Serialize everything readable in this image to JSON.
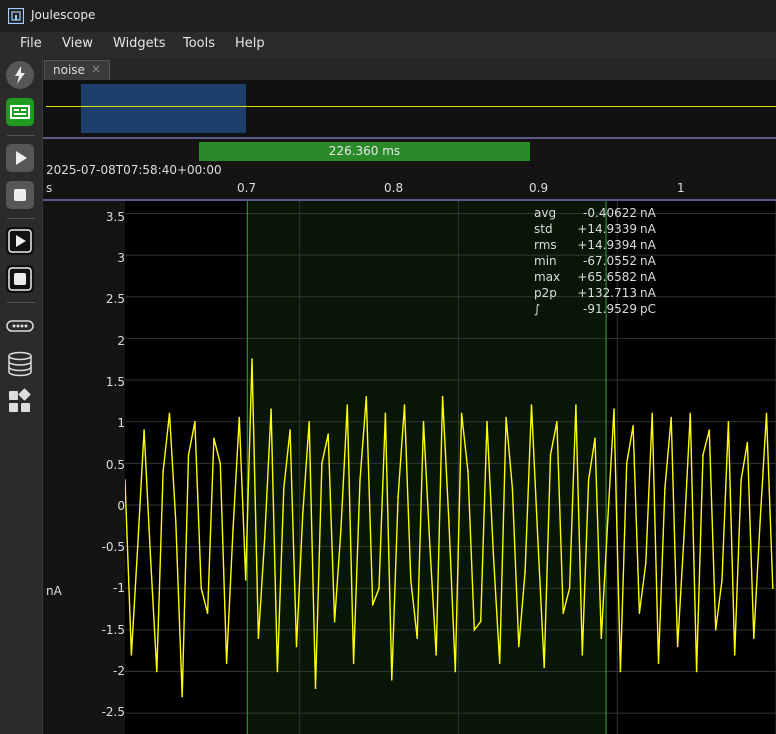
{
  "app": {
    "title": "Joulescope"
  },
  "menu": [
    "File",
    "View",
    "Widgets",
    "Tools",
    "Help"
  ],
  "tab": {
    "label": "noise",
    "close": "×"
  },
  "timeline": {
    "duration": "226.360 ms",
    "timestamp": "2025-07-08T07:58:40+00:00",
    "unit": "s",
    "ticks": [
      "0.7",
      "0.8",
      "0.9",
      "1"
    ]
  },
  "y_axis": {
    "unit": "nA",
    "ticks": [
      "3.5",
      "3",
      "2.5",
      "2",
      "1.5",
      "1",
      "0.5",
      "0",
      "-0.5",
      "-1",
      "-1.5",
      "-2",
      "-2.5"
    ]
  },
  "stats": [
    {
      "label": "avg",
      "value": "-0.40622",
      "unit": "nA"
    },
    {
      "label": "std",
      "value": "+14.9339",
      "unit": "nA"
    },
    {
      "label": "rms",
      "value": "+14.9394",
      "unit": "nA"
    },
    {
      "label": "min",
      "value": "-67.0552",
      "unit": "nA"
    },
    {
      "label": "max",
      "value": "+65.6582",
      "unit": "nA"
    },
    {
      "label": "p2p",
      "value": "+132.713",
      "unit": "nA"
    },
    {
      "label": "∫",
      "value": "-91.9529",
      "unit": "pC"
    }
  ],
  "sidebar_icons": [
    "lightning-icon",
    "multimeter-icon",
    "play-icon",
    "stop-icon",
    "record-play-icon",
    "record-stop-icon",
    "ellipsis-icon",
    "database-icon",
    "widgets-icon"
  ],
  "colors": {
    "trace": "#ffff00",
    "selection": "#2a8a2a",
    "overview_window": "#1c3f6b"
  },
  "chart_data": {
    "type": "line",
    "xlabel": "s",
    "ylabel": "nA",
    "xlim": [
      0.59,
      1.0
    ],
    "ylim": [
      -2.75,
      3.65
    ],
    "selection": [
      0.667,
      0.893
    ],
    "series": [
      {
        "x": [
          0.59,
          0.594,
          0.598,
          0.602,
          0.606,
          0.61,
          0.614,
          0.618,
          0.622,
          0.626,
          0.63,
          0.634,
          0.638,
          0.642,
          0.646,
          0.65,
          0.654,
          0.658,
          0.662,
          0.666,
          0.67,
          0.674,
          0.678,
          0.682,
          0.686,
          0.69,
          0.694,
          0.698,
          0.702,
          0.706,
          0.71,
          0.714,
          0.718,
          0.722,
          0.726,
          0.73,
          0.734,
          0.738,
          0.742,
          0.746,
          0.75,
          0.754,
          0.758,
          0.762,
          0.766,
          0.77,
          0.774,
          0.778,
          0.782,
          0.786,
          0.79,
          0.794,
          0.798,
          0.802,
          0.806,
          0.81,
          0.814,
          0.818,
          0.822,
          0.826,
          0.83,
          0.834,
          0.838,
          0.842,
          0.846,
          0.85,
          0.854,
          0.858,
          0.862,
          0.866,
          0.87,
          0.874,
          0.878,
          0.882,
          0.886,
          0.89,
          0.894,
          0.898,
          0.902,
          0.906,
          0.91,
          0.914,
          0.918,
          0.922,
          0.926,
          0.93,
          0.934,
          0.938,
          0.942,
          0.946,
          0.95,
          0.954,
          0.958,
          0.962,
          0.966,
          0.97,
          0.974,
          0.978,
          0.982,
          0.986,
          0.99,
          0.994,
          0.998
        ],
        "values": [
          0.3,
          -1.8,
          -0.5,
          0.9,
          -0.6,
          -2.0,
          0.4,
          1.1,
          -0.2,
          -2.3,
          0.6,
          1.0,
          -1.0,
          -1.3,
          0.8,
          0.5,
          -1.9,
          -0.3,
          1.05,
          -0.9,
          1.75,
          -1.6,
          -0.4,
          1.15,
          -2.0,
          0.2,
          0.9,
          -1.7,
          -0.1,
          1.0,
          -2.2,
          0.5,
          0.85,
          -1.4,
          -0.3,
          1.2,
          -1.9,
          0.3,
          1.3,
          -1.2,
          -1.0,
          1.1,
          -2.1,
          0.1,
          1.2,
          -0.9,
          -1.6,
          1.0,
          -0.5,
          -1.8,
          1.3,
          -0.2,
          -2.0,
          1.1,
          0.4,
          -1.5,
          -1.4,
          1.0,
          -0.6,
          -1.9,
          1.05,
          0.2,
          -1.7,
          -0.8,
          1.2,
          -0.4,
          -1.95,
          0.6,
          1.0,
          -1.3,
          -1.0,
          1.2,
          -1.8,
          0.3,
          0.8,
          -1.6,
          -0.2,
          1.15,
          -2.0,
          0.5,
          0.95,
          -1.3,
          -0.7,
          1.1,
          -1.9,
          0.2,
          1.05,
          -1.7,
          -0.4,
          1.1,
          -2.0,
          0.6,
          0.9,
          -1.5,
          -0.9,
          1.0,
          -1.8,
          0.3,
          0.75,
          -1.6,
          -0.2,
          1.1,
          -1.0
        ]
      }
    ]
  }
}
